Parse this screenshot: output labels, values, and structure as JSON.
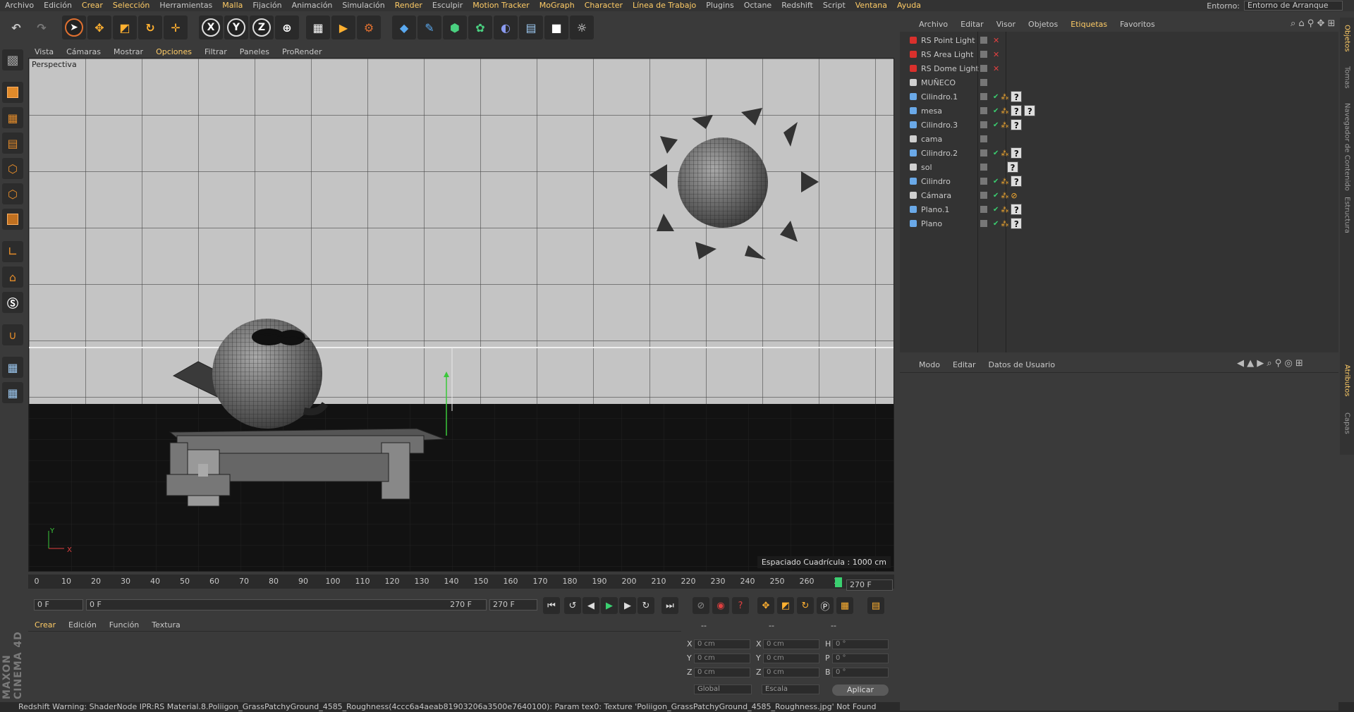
{
  "menubar": {
    "items": [
      {
        "label": "Archivo",
        "style": "normal"
      },
      {
        "label": "Edición",
        "style": "normal"
      },
      {
        "label": "Crear",
        "style": "hl"
      },
      {
        "label": "Selección",
        "style": "hl"
      },
      {
        "label": "Herramientas",
        "style": "normal"
      },
      {
        "label": "Malla",
        "style": "hl"
      },
      {
        "label": "Fijación",
        "style": "normal"
      },
      {
        "label": "Animación",
        "style": "normal"
      },
      {
        "label": "Simulación",
        "style": "normal"
      },
      {
        "label": "Render",
        "style": "hl"
      },
      {
        "label": "Esculpir",
        "style": "normal"
      },
      {
        "label": "Motion Tracker",
        "style": "hl"
      },
      {
        "label": "MoGraph",
        "style": "hl"
      },
      {
        "label": "Character",
        "style": "hl"
      },
      {
        "label": "Línea de Trabajo",
        "style": "hl"
      },
      {
        "label": "Plugins",
        "style": "normal"
      },
      {
        "label": "Octane",
        "style": "normal"
      },
      {
        "label": "Redshift",
        "style": "normal"
      },
      {
        "label": "Script",
        "style": "normal"
      },
      {
        "label": "Ventana",
        "style": "hl"
      },
      {
        "label": "Ayuda",
        "style": "hl"
      }
    ],
    "entorno_label": "Entorno:",
    "entorno_value": "Entorno de Arranque"
  },
  "viewport": {
    "menu": [
      "Vista",
      "Cámaras",
      "Mostrar",
      "Opciones",
      "Filtrar",
      "Paneles",
      "ProRender"
    ],
    "menu_highlight": "Opciones",
    "label": "Perspectiva",
    "grid_info": "Espaciado Cuadrícula : 1000 cm",
    "axis_y": "Y",
    "axis_x": "X"
  },
  "timeline": {
    "ticks": [
      "0",
      "10",
      "20",
      "30",
      "40",
      "50",
      "60",
      "70",
      "80",
      "90",
      "100",
      "110",
      "120",
      "130",
      "140",
      "150",
      "160",
      "170",
      "180",
      "190",
      "200",
      "210",
      "220",
      "230",
      "240",
      "250",
      "260",
      "2"
    ],
    "frame_end": "270 F",
    "current_start": "0 F",
    "range_start": "0 F",
    "range_end": "270 F",
    "max_frame": "270 F"
  },
  "material": {
    "tabs": [
      "Crear",
      "Edición",
      "Función",
      "Textura"
    ]
  },
  "coords": {
    "headers": [
      "--",
      "--",
      "--"
    ],
    "rows": [
      {
        "a": "X",
        "av": "0 cm",
        "b": "X",
        "bv": "0 cm",
        "c": "H",
        "cv": "0 °"
      },
      {
        "a": "Y",
        "av": "0 cm",
        "b": "Y",
        "bv": "0 cm",
        "c": "P",
        "cv": "0 °"
      },
      {
        "a": "Z",
        "av": "0 cm",
        "b": "Z",
        "bv": "0 cm",
        "c": "B",
        "cv": "0 °"
      }
    ],
    "space": "Global",
    "scale": "Escala",
    "apply": "Aplicar"
  },
  "object_manager": {
    "tabs": [
      "Archivo",
      "Editar",
      "Visor",
      "Objetos",
      "Etiquetas",
      "Favoritos"
    ],
    "active_tab": "Etiquetas",
    "objects": [
      {
        "name": "RS Point Light",
        "icon": "light-icon",
        "color": "#d9302c",
        "tags": "x"
      },
      {
        "name": "RS Area Light",
        "icon": "light-icon",
        "color": "#d9302c",
        "tags": "x"
      },
      {
        "name": "RS Dome Light",
        "icon": "light-icon",
        "color": "#d9302c",
        "tags": "x"
      },
      {
        "name": "MUÑECO",
        "icon": "null-icon",
        "color": "#cfcfcf",
        "tags": ""
      },
      {
        "name": "Cilindro.1",
        "icon": "cylinder-icon",
        "color": "#6aa9e8",
        "tags": "mat"
      },
      {
        "name": "mesa",
        "icon": "joint-icon",
        "color": "#6aa9e8",
        "tags": "mat2"
      },
      {
        "name": "Cilindro.3",
        "icon": "cylinder-icon",
        "color": "#6aa9e8",
        "tags": "mat"
      },
      {
        "name": "cama",
        "icon": "null-icon",
        "color": "#cfcfcf",
        "tags": ""
      },
      {
        "name": "Cilindro.2",
        "icon": "cylinder-icon",
        "color": "#6aa9e8",
        "tags": "mat"
      },
      {
        "name": "sol",
        "icon": "null-icon",
        "color": "#cfcfcf",
        "tags": "q"
      },
      {
        "name": "Cilindro",
        "icon": "cylinder-icon",
        "color": "#6aa9e8",
        "tags": "mat"
      },
      {
        "name": "Cámara",
        "icon": "camera-icon",
        "color": "#cfcfcf",
        "tags": "cam"
      },
      {
        "name": "Plano.1",
        "icon": "plane-icon",
        "color": "#6aa9e8",
        "tags": "mat"
      },
      {
        "name": "Plano",
        "icon": "plane-icon",
        "color": "#6aa9e8",
        "tags": "mat"
      }
    ]
  },
  "attribute_manager": {
    "tabs": [
      "Modo",
      "Editar",
      "Datos de Usuario"
    ]
  },
  "right_tabs": [
    "Objetos",
    "Tomas",
    "Navegador de Contenido",
    "Estructura",
    "Atributos",
    "Capas"
  ],
  "brand": "MAXON CINEMA 4D",
  "status": "Redshift Warning: ShaderNode IPR:RS Material.8.Poliigon_GrassPatchyGround_4585_Roughness(4ccc6a4aeab81903206a3500e7640100): Param tex0: Texture 'Poliigon_GrassPatchyGround_4585_Roughness.jpg' Not Found"
}
